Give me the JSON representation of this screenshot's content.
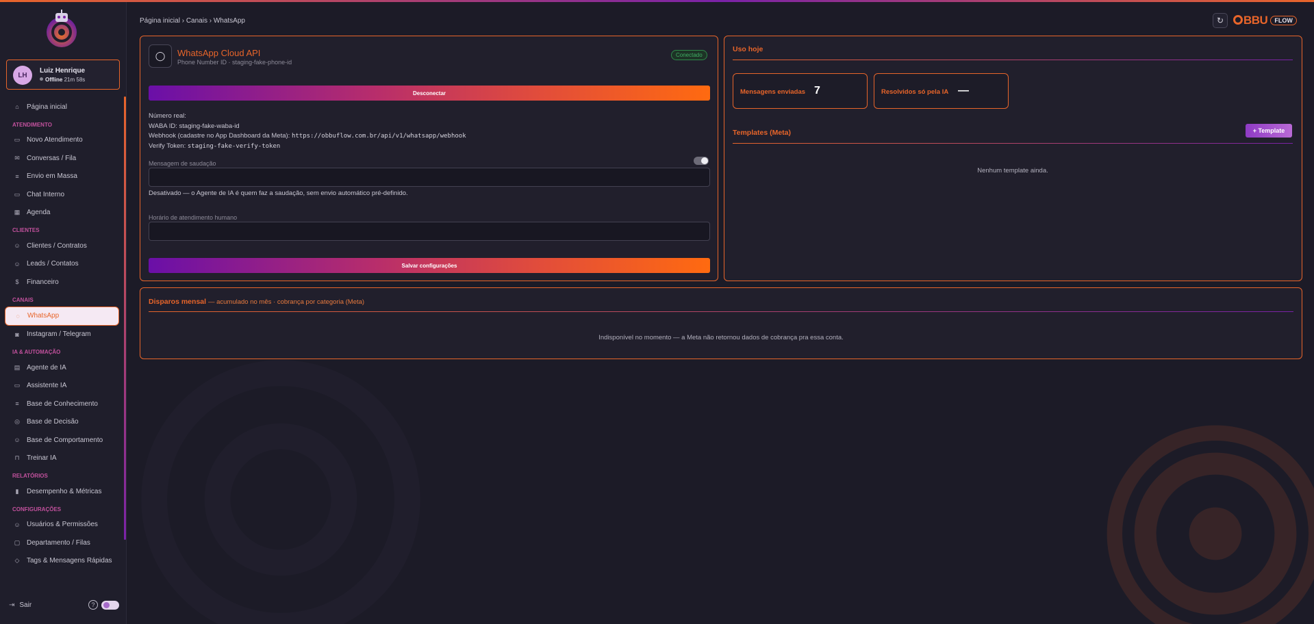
{
  "breadcrumb": "Página inicial › Canais › WhatsApp",
  "brand": {
    "name": "BBU",
    "badge": "FLOW",
    "accent": "#e8652a",
    "secondary": "#7a22a8"
  },
  "user": {
    "initials": "LH",
    "name": "Luiz Henrique",
    "status": "Offline",
    "time": "21m 58s"
  },
  "sidebar": {
    "home": "Página inicial",
    "sections": [
      {
        "title": "ATENDIMENTO",
        "items": [
          {
            "label": "Novo Atendimento",
            "icon": "chat-icon"
          },
          {
            "label": "Conversas / Fila",
            "icon": "mail-icon"
          },
          {
            "label": "Envio em Massa",
            "icon": "list-icon"
          },
          {
            "label": "Chat Interno",
            "icon": "chat-icon"
          },
          {
            "label": "Agenda",
            "icon": "calendar-icon"
          }
        ]
      },
      {
        "title": "CLIENTES",
        "items": [
          {
            "label": "Clientes / Contratos",
            "icon": "user-icon"
          },
          {
            "label": "Leads / Contatos",
            "icon": "user-add-icon"
          },
          {
            "label": "Financeiro",
            "icon": "dollar-icon"
          }
        ]
      },
      {
        "title": "CANAIS",
        "items": [
          {
            "label": "WhatsApp",
            "icon": "whatsapp-icon",
            "active": true
          },
          {
            "label": "Instagram / Telegram",
            "icon": "instagram-icon"
          }
        ]
      },
      {
        "title": "IA & AUTOMAÇÃO",
        "items": [
          {
            "label": "Agente de IA",
            "icon": "doc-icon"
          },
          {
            "label": "Assistente IA",
            "icon": "chat-icon"
          },
          {
            "label": "Base de Conhecimento",
            "icon": "list-icon"
          },
          {
            "label": "Base de Decisão",
            "icon": "target-icon"
          },
          {
            "label": "Base de Comportamento",
            "icon": "user-icon"
          },
          {
            "label": "Treinar IA",
            "icon": "lock-icon"
          }
        ]
      },
      {
        "title": "RELATÓRIOS",
        "items": [
          {
            "label": "Desempenho & Métricas",
            "icon": "chart-icon"
          }
        ]
      },
      {
        "title": "CONFIGURAÇÕES",
        "items": [
          {
            "label": "Usuários & Permissões",
            "icon": "users-icon"
          },
          {
            "label": "Departamento / Filas",
            "icon": "briefcase-icon"
          },
          {
            "label": "Tags & Mensagens Rápidas",
            "icon": "tag-icon"
          }
        ]
      }
    ],
    "logout": "Sair",
    "help": "?"
  },
  "whatsapp": {
    "title": "WhatsApp Cloud API",
    "subtitle": "Phone Number ID · staging-fake-phone-id",
    "status": "Conectado",
    "status_color": "#3fae63",
    "disconnect_label": "Desconectar",
    "real_number_label": "Número real:",
    "waba": "WABA ID: staging-fake-waba-id",
    "webhook_label": "Webhook (cadastre no App Dashboard da Meta):",
    "webhook_url": "https://obbuflow.com.br/api/v1/whatsapp/webhook",
    "verify_label": "Verify Token:",
    "verify_token": "staging-fake-verify-token",
    "greeting_label": "Mensagem de saudação",
    "greeting_value": "",
    "greeting_help": "Desativado — o Agente de IA é quem faz a saudação, sem envio automático pré-definido.",
    "hours_label": "Horário de atendimento humano",
    "hours_value": "",
    "save_label": "Salvar configurações"
  },
  "usage": {
    "title": "Uso hoje",
    "sent_label": "Mensagens enviadas",
    "sent_value": "7",
    "ai_label": "Resolvidos só pela IA",
    "ai_value": "—",
    "templates_title": "Templates (Meta)",
    "template_button": "+ Template",
    "templates_empty": "Nenhum template ainda."
  },
  "disparos": {
    "title": "Disparos mensal",
    "subtitle": "— acumulado no mês · cobrança por categoria (Meta)",
    "empty": "Indisponível no momento — a Meta não retornou dados de cobrança pra essa conta."
  }
}
